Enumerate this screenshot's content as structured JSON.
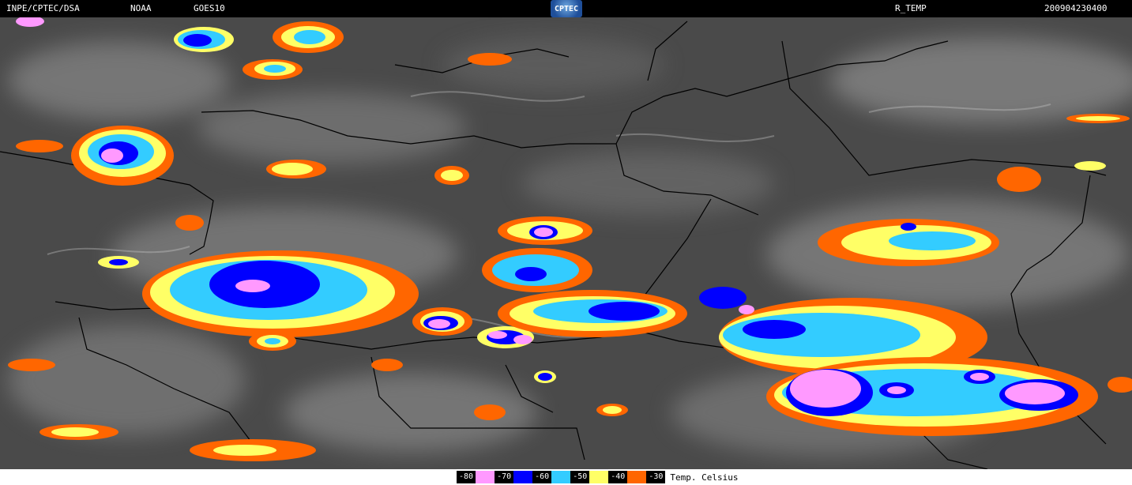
{
  "header": {
    "institution": "INPE/CPTEC/DSA",
    "agency": "NOAA",
    "satellite": "GOES10",
    "logo_text": "CPTEC",
    "product": "R_TEMP",
    "timestamp": "200904230400"
  },
  "legend": {
    "unit_label": "Temp. Celsius",
    "items": [
      {
        "value": "-80",
        "color": "#ff99ff"
      },
      {
        "value": "-70",
        "color": "#0000ff"
      },
      {
        "value": "-60",
        "color": "#33ccff"
      },
      {
        "value": "-50",
        "color": "#ffff66"
      },
      {
        "value": "-40",
        "color": "#ff6600"
      },
      {
        "value": "-30",
        "color": "#000000"
      }
    ]
  },
  "colors": {
    "background_cloud": "#4a4a4a",
    "orange": "#ff6600",
    "yellow": "#ffff66",
    "cyan": "#33ccff",
    "blue": "#0000ff",
    "pink": "#ff99ff"
  }
}
